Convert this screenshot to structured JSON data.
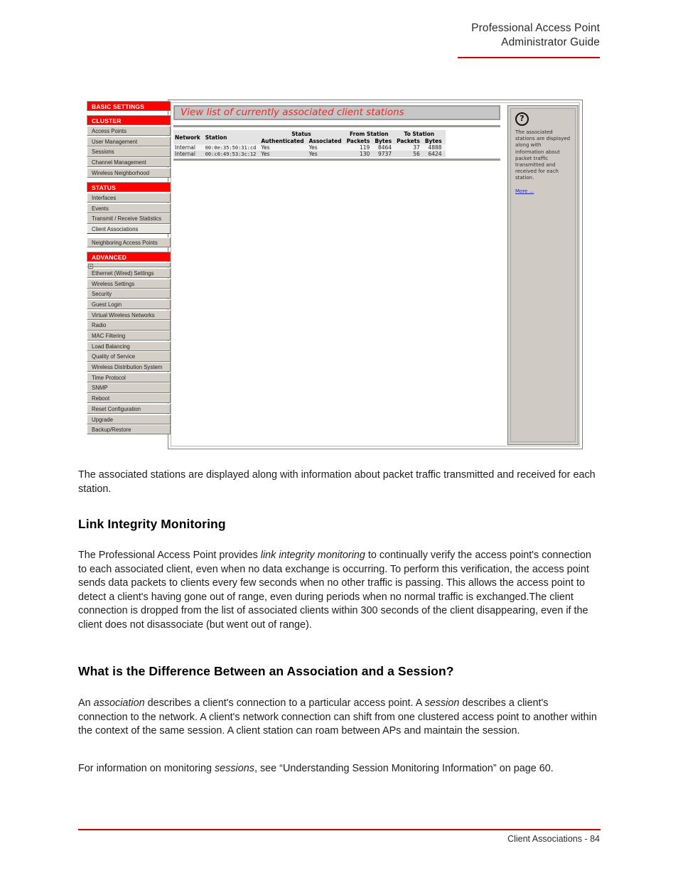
{
  "header": {
    "line1": "Professional Access Point",
    "line2": "Administrator Guide"
  },
  "footer": {
    "text": "Client Associations - 84"
  },
  "screenshot": {
    "panel_title": "View list of currently associated client stations",
    "sidebar": {
      "sections": [
        {
          "label": "BASIC SETTINGS",
          "items": []
        },
        {
          "label": "CLUSTER",
          "items": [
            "Access Points",
            "User Management",
            "Sessions",
            "Channel Management",
            "Wireless Neighborhood"
          ]
        },
        {
          "label": "STATUS",
          "items": [
            "Interfaces",
            "Events",
            "Transmit / Receive Statistics",
            "Client Associations",
            "Neighboring Access Points"
          ]
        },
        {
          "label": "ADVANCED",
          "items": [
            "Ethernet (Wired) Settings",
            "Wireless Settings",
            "Security",
            "Guest Login",
            "Virtual Wireless Networks",
            "Radio",
            "MAC Filtering",
            "Load Balancing",
            "Quality of Service",
            "Wireless Distribution System",
            "Time Protocol",
            "SNMP",
            "Reboot",
            "Reset Configuration",
            "Upgrade",
            "Backup/Restore"
          ]
        }
      ],
      "selected_item": "Client Associations"
    },
    "table": {
      "group_headers": {
        "network": "Network",
        "station": "Station",
        "status": "Status",
        "from_station": "From Station",
        "to_station": "To Station"
      },
      "sub_headers": {
        "authenticated": "Authenticated",
        "associated": "Associated",
        "from_packets": "Packets",
        "from_bytes": "Bytes",
        "to_packets": "Packets",
        "to_bytes": "Bytes"
      },
      "rows": [
        {
          "network": "Internal",
          "station": "00:0e:35:50:31:cd",
          "authenticated": "Yes",
          "associated": "Yes",
          "from_packets": "119",
          "from_bytes": "8464",
          "to_packets": "37",
          "to_bytes": "4888"
        },
        {
          "network": "Internal",
          "station": "00:c0:49:53:3c:12",
          "authenticated": "Yes",
          "associated": "Yes",
          "from_packets": "130",
          "from_bytes": "9737",
          "to_packets": "56",
          "to_bytes": "6424"
        }
      ]
    },
    "help": {
      "icon": "question-mark-icon",
      "text": "The associated stations are displayed along with information about packet traffic transmitted and received for each station.",
      "more_link": "More ..."
    }
  },
  "body": {
    "intro": "The associated stations are displayed along with information about packet traffic transmitted and received for each station.",
    "heading_link_integrity": "Link Integrity Monitoring",
    "para_link_integrity_1": "The Professional Access Point provides ",
    "para_link_integrity_em": "link integrity monitoring",
    "para_link_integrity_2": " to continually verify the access point's connection to each associated client, even when no data exchange is occurring. To perform this verification, the access point sends data packets to clients every few seconds when no other traffic is passing. This allows the access point to detect a client's having gone out of range, even during periods when no normal traffic is exchanged.The client connection is dropped from the list of associated clients within 300 seconds of the client disappearing, even if the client does not disassociate (but went out of range).",
    "heading_association_session": "What is the Difference Between an Association and a Session?",
    "para_assoc_1": "An ",
    "para_assoc_em1": "association",
    "para_assoc_2": " describes a client's connection to a particular access point. A ",
    "para_assoc_em2": "session",
    "para_assoc_3": " describes a client's connection to the network. A client's network connection can shift from one clustered access point to another within the context of the same session. A client station can roam between APs and maintain the session.",
    "para_xref_1": "For information on monitoring ",
    "para_xref_em": "sessions",
    "para_xref_2": ", see “Understanding Session Monitoring Information” on page 60."
  },
  "colors": {
    "brand_red": "#ff0000",
    "rule_red": "#cc0000",
    "panel_grey": "#c6c6c6",
    "nav_grey": "#d4d0c8",
    "link_blue": "#2323c8"
  }
}
